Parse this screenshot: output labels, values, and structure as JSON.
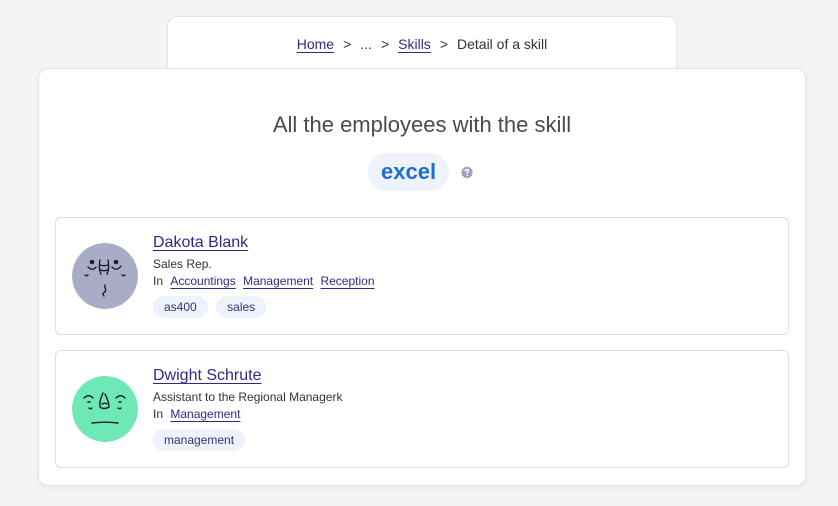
{
  "breadcrumb": {
    "home": "Home",
    "sep1": ">",
    "ellipsis": "...",
    "sep2": ">",
    "skills": "Skills",
    "sep3": ">",
    "current": "Detail of a skill"
  },
  "page": {
    "title": "All the employees with the skill",
    "skill": "excel",
    "help_icon": "question-badge-icon"
  },
  "employees": [
    {
      "name": "Dakota Blank",
      "title": "Sales Rep.",
      "in_label": "In",
      "teams": [
        "Accountings",
        "Management",
        "Reception"
      ],
      "skills": [
        "as400",
        "sales"
      ],
      "avatar_color": "#a8acc6"
    },
    {
      "name": "Dwight Schrute",
      "title": "Assistant to the Regional Managerk",
      "in_label": "In",
      "teams": [
        "Management"
      ],
      "skills": [
        "management"
      ],
      "avatar_color": "#6ee8b4"
    }
  ],
  "colors": {
    "link": "#2f2a86",
    "skill_accent": "#1b6fc8",
    "background": "#f3f4f6"
  }
}
